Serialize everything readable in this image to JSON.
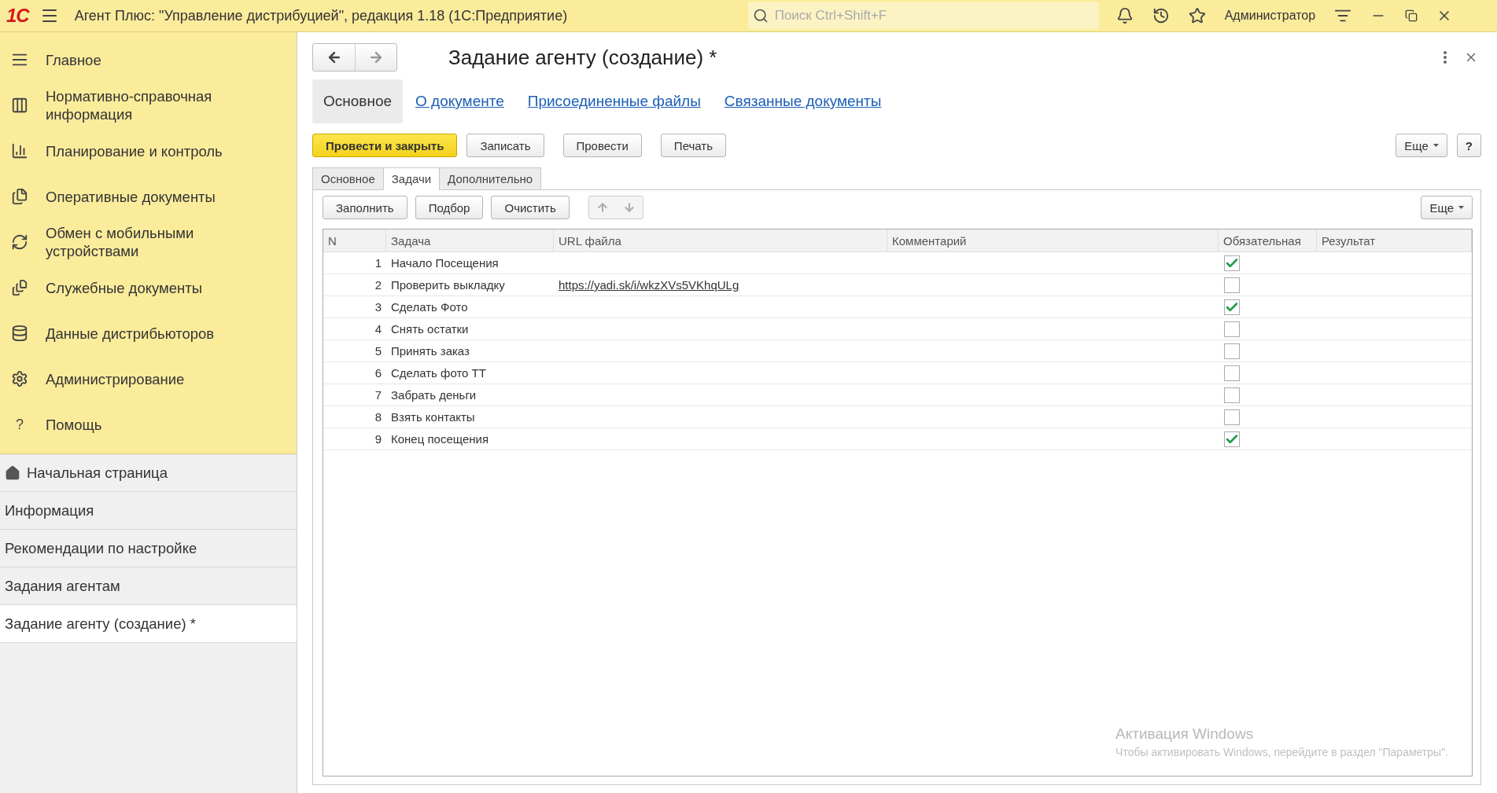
{
  "titlebar": {
    "logo": "1С",
    "title": "Агент Плюс: \"Управление дистрибуцией\", редакция 1.18  (1С:Предприятие)",
    "search_placeholder": "Поиск Ctrl+Shift+F",
    "user": "Администратор"
  },
  "sidebar": {
    "sections": [
      {
        "label": "Главное"
      },
      {
        "label": "Нормативно-справочная информация"
      },
      {
        "label": "Планирование и контроль"
      },
      {
        "label": "Оперативные документы"
      },
      {
        "label": "Обмен с мобильными устройствами"
      },
      {
        "label": "Служебные документы"
      },
      {
        "label": "Данные дистрибьюторов"
      },
      {
        "label": "Администрирование"
      },
      {
        "label": "Помощь",
        "icon_text": "?"
      }
    ],
    "open_windows": [
      {
        "label": "Начальная страница",
        "selected": false
      },
      {
        "label": "Информация",
        "selected": false
      },
      {
        "label": "Рекомендации по настройке",
        "selected": false
      },
      {
        "label": "Задания агентам",
        "selected": false
      },
      {
        "label": "Задание агенту (создание) *",
        "selected": true
      }
    ]
  },
  "form": {
    "title": "Задание агенту (создание) *",
    "nav_tabs": [
      {
        "label": "Основное",
        "selected": true
      },
      {
        "label": "О документе",
        "selected": false
      },
      {
        "label": "Присоединенные файлы",
        "selected": false
      },
      {
        "label": "Связанные документы",
        "selected": false
      }
    ],
    "commands": [
      {
        "label": "Провести и закрыть",
        "kind": "primary"
      },
      {
        "label": "Записать",
        "kind": "normal"
      },
      {
        "label": "Провести",
        "kind": "normal"
      },
      {
        "label": "Печать",
        "kind": "normal"
      }
    ],
    "more": "Еще",
    "help": "?",
    "subtabs": [
      {
        "label": "Основное",
        "selected": false
      },
      {
        "label": "Задачи",
        "selected": true
      },
      {
        "label": "Дополнительно",
        "selected": false
      }
    ],
    "table_commands": [
      "Заполнить",
      "Подбор",
      "Очистить"
    ],
    "table_more": "Еще",
    "columns": [
      "N",
      "Задача",
      "URL файла",
      "Комментарий",
      "Обязательная",
      "Результат"
    ],
    "rows": [
      {
        "n": "1",
        "task": "Начало Посещения",
        "required": true
      },
      {
        "n": "2",
        "task": "Проверить выкладку",
        "url": "https://yadi.sk/i/wkzXVs5VKhqULg",
        "required": false
      },
      {
        "n": "3",
        "task": "Сделать Фото",
        "required": true
      },
      {
        "n": "4",
        "task": "Снять остатки",
        "required": false
      },
      {
        "n": "5",
        "task": "Принять заказ",
        "required": false
      },
      {
        "n": "6",
        "task": "Сделать фото ТТ",
        "required": false
      },
      {
        "n": "7",
        "task": "Забрать деньги",
        "required": false
      },
      {
        "n": "8",
        "task": "Взять контакты",
        "required": false
      },
      {
        "n": "9",
        "task": "Конец посещения",
        "required": true
      }
    ]
  },
  "activation": {
    "title": "Активация Windows",
    "text": "Чтобы активировать Windows, перейдите в раздел \"Параметры\"."
  }
}
